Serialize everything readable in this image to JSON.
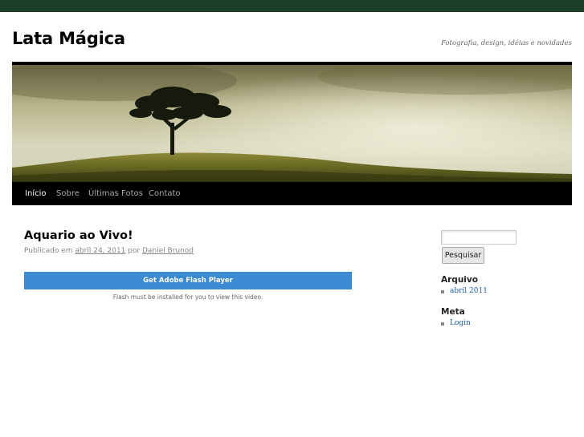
{
  "site": {
    "title": "Lata Mágica",
    "description": "Fotografia, design, idéias e novidades"
  },
  "colors": {
    "top_bar": "#1d3e29",
    "nav_background": "#000000",
    "flash_button": "#3c8ad2",
    "link": "#1b5dab"
  },
  "nav": {
    "items": [
      {
        "label": "Início",
        "active": true
      },
      {
        "label": "Sobre",
        "active": false
      },
      {
        "label": "Últimas Fotos",
        "active": false
      },
      {
        "label": "Contato",
        "active": false
      }
    ]
  },
  "post": {
    "title": "Aquario ao Vivo!",
    "meta_prefix": "Publicado em",
    "date": "abril 24, 2011",
    "meta_by": "por",
    "author": "Daniel Brunod",
    "flash_button_label": "Get Adobe Flash Player",
    "flash_note": "Flash must be installed for you to view this video."
  },
  "sidebar": {
    "search_value": "",
    "search_button": "Pesquisar",
    "archive_title": "Arquivo",
    "archive_items": [
      "abril 2011"
    ],
    "meta_title": "Meta",
    "meta_items": [
      "Login"
    ]
  }
}
